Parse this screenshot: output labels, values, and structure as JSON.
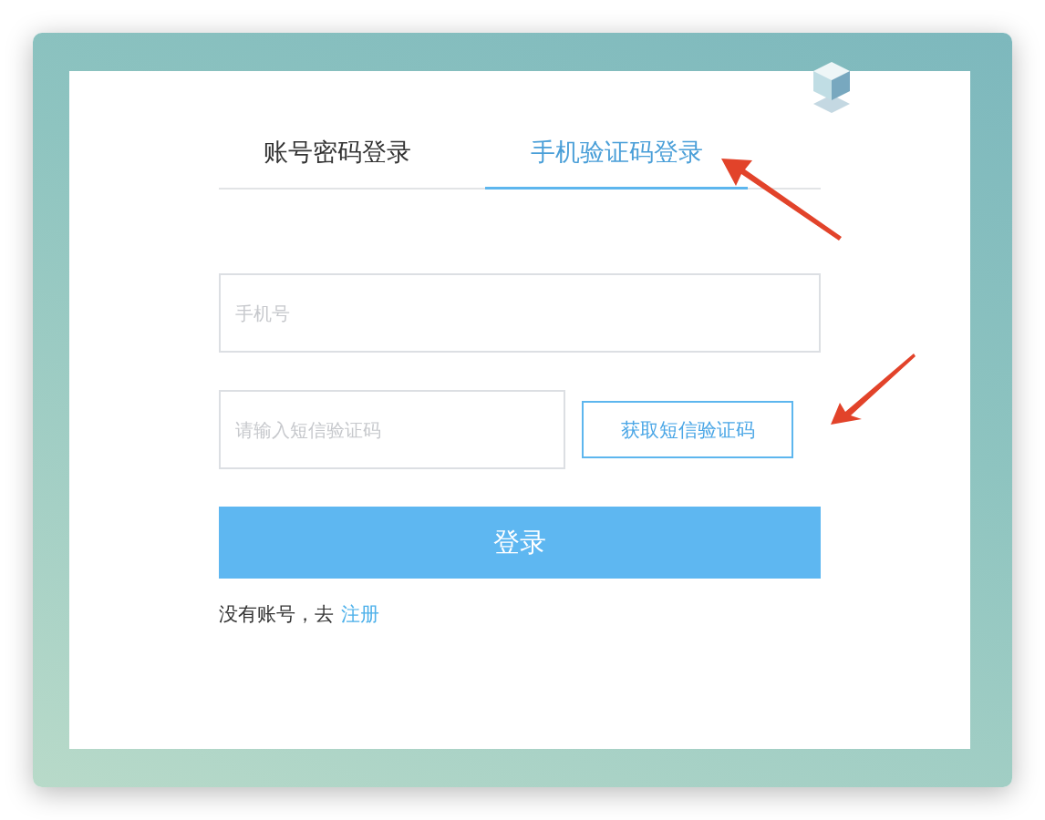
{
  "tabs": [
    {
      "label": "账号密码登录",
      "selected": false
    },
    {
      "label": "手机验证码登录",
      "selected": true
    }
  ],
  "form": {
    "phone": {
      "placeholder": "手机号"
    },
    "sms_code": {
      "placeholder": "请输入短信验证码"
    },
    "send_code_button": "获取短信验证码",
    "login_button": "登录",
    "register_prompt": {
      "text": "没有账号，去",
      "link": "注册"
    }
  }
}
